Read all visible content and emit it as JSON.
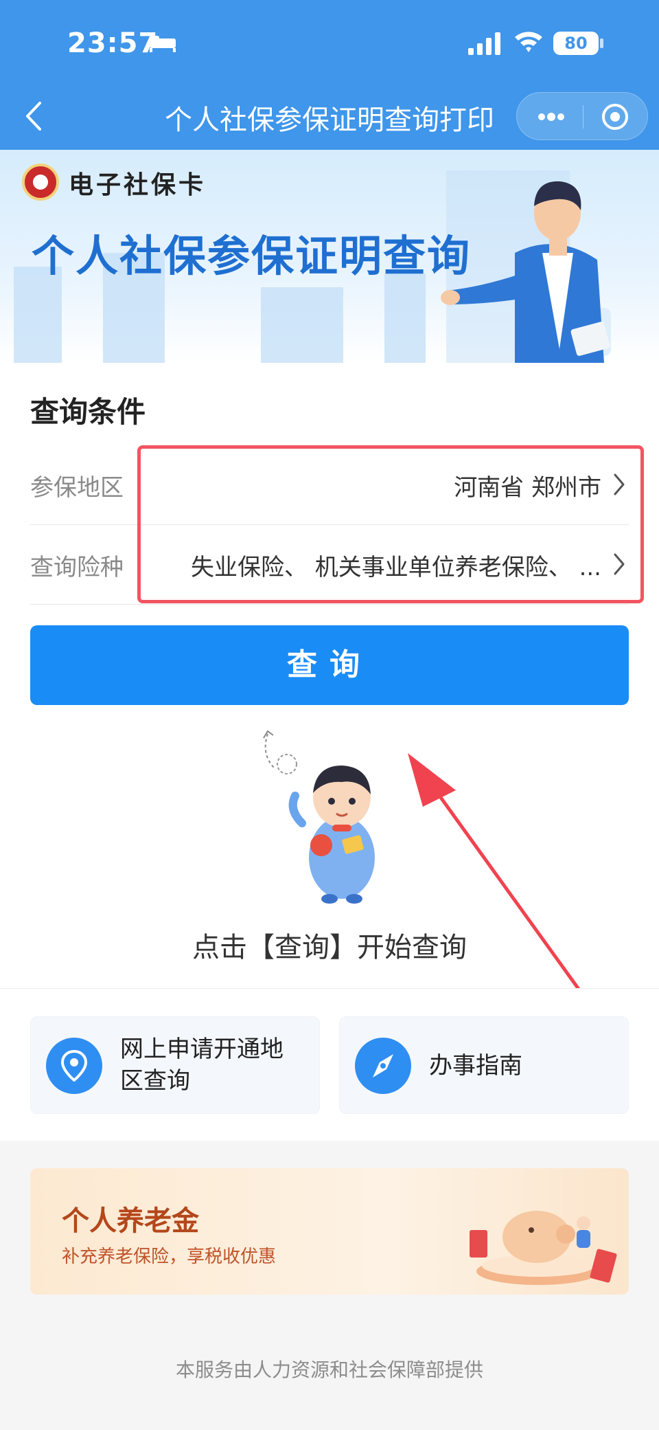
{
  "status_bar": {
    "time": "23:57",
    "battery": "80"
  },
  "nav": {
    "title": "个人社保参保证明查询打印"
  },
  "banner": {
    "logo_text": "电子社保卡",
    "title": "个人社保参保证明查询"
  },
  "query": {
    "section_title": "查询条件",
    "region_label": "参保地区",
    "region_value": "河南省 郑州市",
    "insurance_label": "查询险种",
    "insurance_value": "失业保险、 机关事业单位养老保险、 ...",
    "button_label": "查询",
    "hint": "点击【查询】开始查询"
  },
  "links": [
    {
      "label": "网上申请开通地区查询",
      "icon": "location-pin-icon"
    },
    {
      "label": "办事指南",
      "icon": "compass-icon"
    }
  ],
  "promo": {
    "title": "个人养老金",
    "subtitle": "补充养老保险，享税收优惠"
  },
  "footer": "本服务由人力资源和社会保障部提供",
  "colors": {
    "header": "#3f96ea",
    "primary_button": "#1a8cf5",
    "highlight": "#f25560",
    "promo_title": "#b4471b"
  }
}
